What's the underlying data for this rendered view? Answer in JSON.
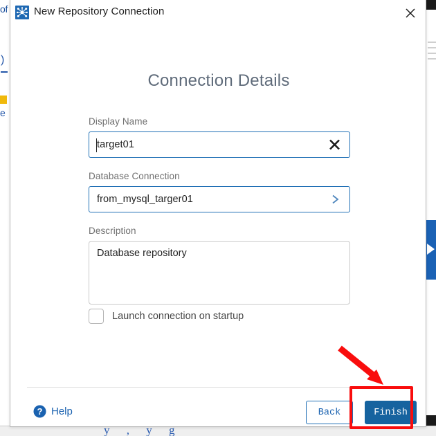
{
  "window": {
    "title": "New Repository Connection",
    "app_icon": "network-nodes-icon",
    "close_icon": "close-icon"
  },
  "page": {
    "heading": "Connection Details"
  },
  "fields": {
    "display_name": {
      "label": "Display Name",
      "value": "target01",
      "placeholder": "Display Name",
      "clear_icon": "clear-x-icon"
    },
    "database_connection": {
      "label": "Database Connection",
      "value": "from_mysql_targer01",
      "chevron_icon": "chevron-right-icon"
    },
    "description": {
      "label": "Description",
      "value": "Database repository",
      "placeholder": "Description"
    },
    "launch_on_startup": {
      "label": "Launch connection on startup",
      "checked": false
    }
  },
  "footer": {
    "help_label": "Help",
    "help_icon": "question-circle-icon",
    "back_label": "Back",
    "finish_label": "Finish"
  },
  "background": {
    "top_left_fragment": "of",
    "left_fragment_a": ")",
    "left_fragment_e": "e",
    "bottom_text": "y           , y         g"
  },
  "colors": {
    "accent_blue": "#16639f",
    "link_blue": "#1a62b0",
    "focus_border": "#1f6fb5",
    "annotation_red": "#f90d0d",
    "heading_gray": "#5f6b7a",
    "label_gray": "#6f6f6f"
  }
}
